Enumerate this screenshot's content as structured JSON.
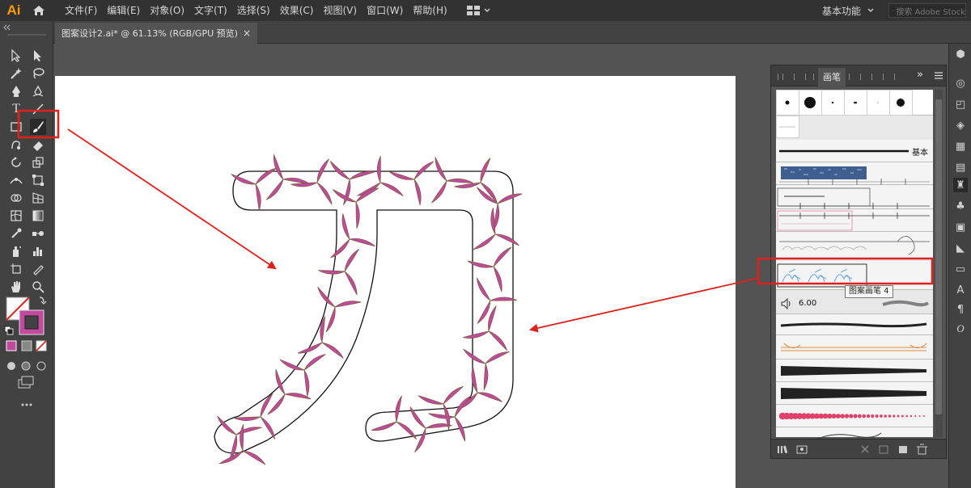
{
  "app": {
    "logo": "Ai"
  },
  "menu": [
    "文件(F)",
    "编辑(E)",
    "对象(O)",
    "文字(T)",
    "选择(S)",
    "效果(C)",
    "视图(V)",
    "窗口(W)",
    "帮助(H)"
  ],
  "workspace": {
    "label": "基本功能"
  },
  "search": {
    "placeholder": "搜索 Adobe Stock"
  },
  "document_tab": {
    "title": "图案设计2.ai* @ 61.13% (RGB/GPU 预览)",
    "close": "×"
  },
  "brush_panel": {
    "tab": "画笔",
    "basic_label": "基本",
    "size_value": "6.00",
    "tooltip": "图案画笔 4",
    "overflow": "»"
  },
  "colors": {
    "accent_red": "#e0201a",
    "petal": "#c04a9e",
    "fill_swatch": "#c04a9e"
  }
}
